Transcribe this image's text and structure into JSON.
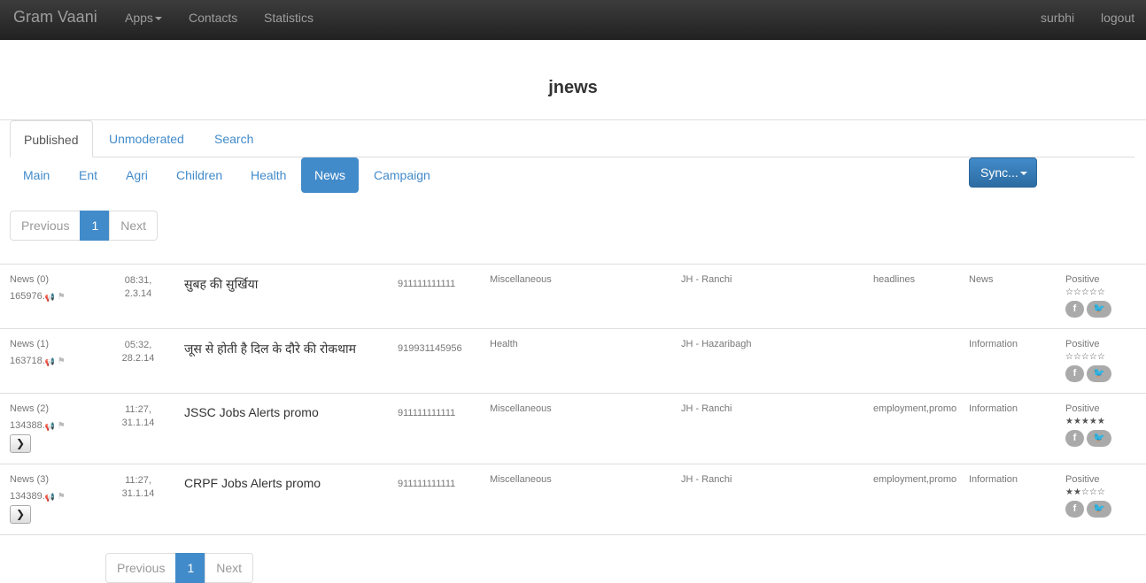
{
  "navbar": {
    "brand": "Gram Vaani",
    "apps": "Apps",
    "contacts": "Contacts",
    "statistics": "Statistics",
    "user": "surbhi",
    "logout": "logout"
  },
  "page_title": "jnews",
  "tabs": [
    "Published",
    "Unmoderated",
    "Search"
  ],
  "pills": [
    "Main",
    "Ent",
    "Agri",
    "Children",
    "Health",
    "News",
    "Campaign"
  ],
  "active_pill": "News",
  "sync_label": "Sync...",
  "pager": {
    "previous": "Previous",
    "page": "1",
    "next": "Next"
  },
  "rows": [
    {
      "label": "News (0)",
      "id": "165976.",
      "time": "08:31,",
      "date": "2.3.14",
      "title": "सुबह की सुर्खिया",
      "phone": "911111111111",
      "category": "Miscellaneous",
      "location": "JH - Ranchi",
      "tags": "headlines",
      "type": "News",
      "sentiment": "Positive",
      "rating": "0 of 5",
      "stars": "☆☆☆☆☆"
    },
    {
      "label": "News (1)",
      "id": "163718.",
      "time": "05:32,",
      "date": "28.2.14",
      "title": "जूस से होती है दिल के दौरे की रोकथाम",
      "phone": "919931145956",
      "category": "Health",
      "location": "JH - Hazaribagh",
      "tags": "",
      "type": "Information",
      "sentiment": "Positive",
      "rating": "0 of 5",
      "stars": "☆☆☆☆☆"
    },
    {
      "label": "News (2)",
      "id": "134388.",
      "time": "11:27,",
      "date": "31.1.14",
      "title": "JSSC Jobs Alerts promo",
      "phone": "911111111111",
      "category": "Miscellaneous",
      "location": "JH - Ranchi",
      "tags": "employment,promo",
      "type": "Information",
      "sentiment": "Positive",
      "rating": "5 of 5",
      "stars": "★★★★★"
    },
    {
      "label": "News (3)",
      "id": "134389.",
      "time": "11:27,",
      "date": "31.1.14",
      "title": "CRPF Jobs Alerts promo",
      "phone": "911111111111",
      "category": "Miscellaneous",
      "location": "JH - Ranchi",
      "tags": "employment,promo",
      "type": "Information",
      "sentiment": "Positive",
      "rating": "2 of 5",
      "stars": "★★☆☆☆"
    }
  ],
  "icons": {
    "megaphone": "megaphone-icon",
    "flag": "flag-icon",
    "expand": "chevron-right-icon",
    "facebook": "facebook-icon",
    "twitter": "twitter-icon"
  },
  "colors": {
    "accent": "#428bca",
    "navbar": "#222222"
  }
}
